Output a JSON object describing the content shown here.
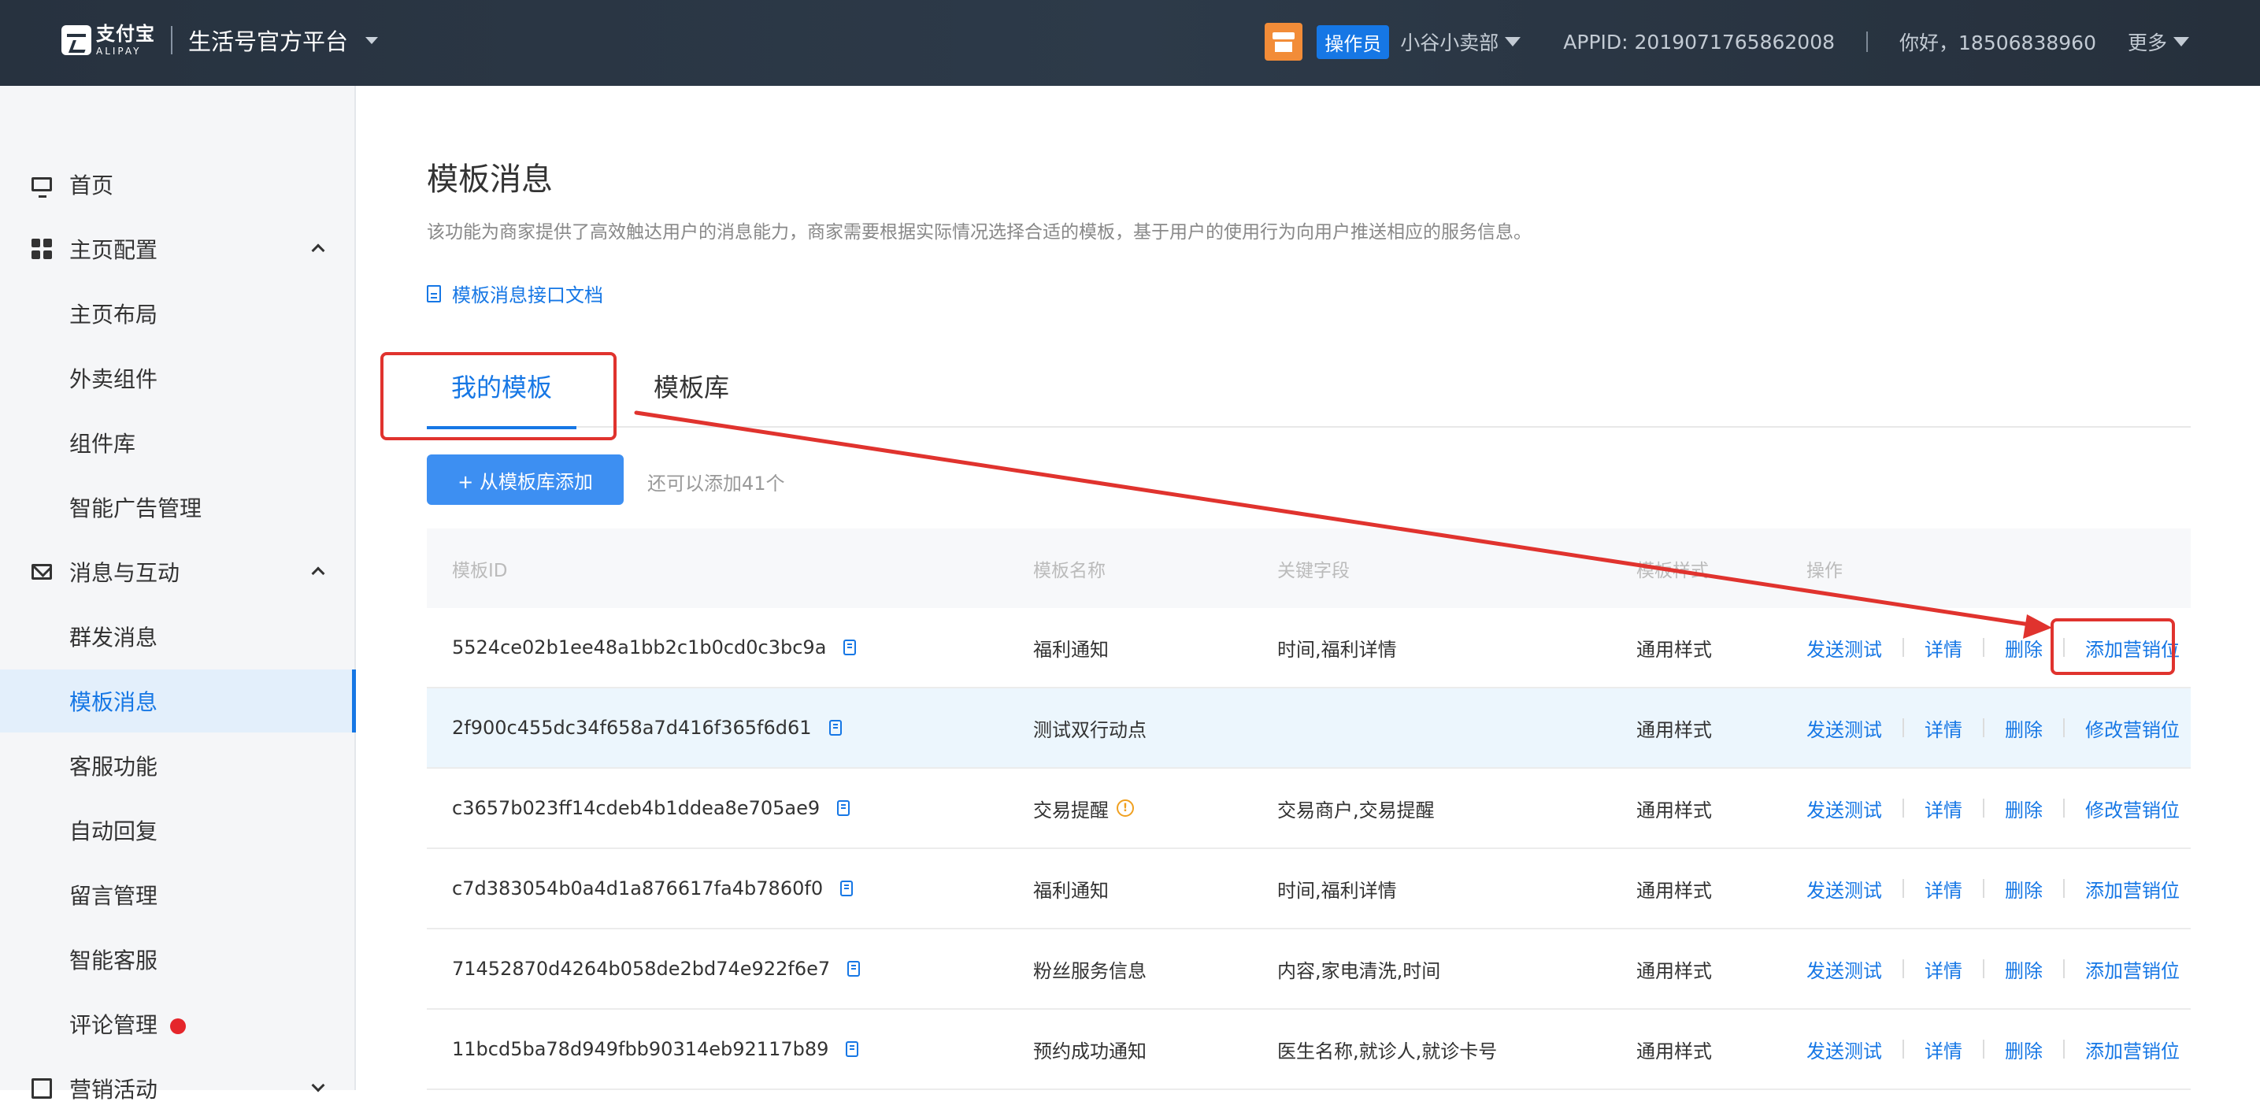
{
  "header": {
    "logo_cn": "支付宝",
    "logo_en": "ALIPAY",
    "platform": "生活号官方平台",
    "role_badge": "操作员",
    "merchant": "小谷小卖部",
    "appid": "APPID: 2019071765862008",
    "greeting": "你好，18506838960",
    "more": "更多"
  },
  "sidebar": {
    "items": [
      {
        "label": "首页",
        "icon": "monitor-icon"
      },
      {
        "label": "主页配置",
        "icon": "grid-icon"
      },
      {
        "label": "主页布局"
      },
      {
        "label": "外卖组件"
      },
      {
        "label": "组件库"
      },
      {
        "label": "智能广告管理"
      },
      {
        "label": "消息与互动",
        "icon": "mail-icon"
      },
      {
        "label": "群发消息"
      },
      {
        "label": "模板消息",
        "active": true
      },
      {
        "label": "客服功能"
      },
      {
        "label": "自动回复"
      },
      {
        "label": "留言管理"
      },
      {
        "label": "智能客服"
      },
      {
        "label": "评论管理"
      },
      {
        "label": "营销活动",
        "icon": "gift-icon"
      }
    ]
  },
  "main": {
    "title": "模板消息",
    "description": "该功能为商家提供了高效触达用户的消息能力，商家需要根据实际情况选择合适的模板，基于用户的使用行为向用户推送相应的服务信息。",
    "doc_link": "模板消息接口文档",
    "tabs": [
      {
        "label": "我的模板",
        "active": true
      },
      {
        "label": "模板库"
      }
    ],
    "add_button": "+ 从模板库添加",
    "remain_text": "还可以添加41个",
    "table": {
      "headers": [
        "模板ID",
        "模板名称",
        "关键字段",
        "模板样式",
        "操作"
      ],
      "rows": [
        {
          "id": "5524ce02b1ee48a1bb2c1b0cd0c3bc9a",
          "name": "福利通知",
          "keys": "时间,福利详情",
          "style": "通用样式",
          "ops": [
            "发送测试",
            "详情",
            "删除",
            "添加营销位"
          ]
        },
        {
          "id": "2f900c455dc34f658a7d416f365f6d61",
          "name": "测试双行动点",
          "keys": "",
          "style": "通用样式",
          "ops": [
            "发送测试",
            "详情",
            "删除",
            "修改营销位"
          ]
        },
        {
          "id": "c3657b023ff14cdeb4b1ddea8e705ae9",
          "name": "交易提醒",
          "keys": "交易商户,交易提醒",
          "style": "通用样式",
          "ops": [
            "发送测试",
            "详情",
            "删除",
            "修改营销位"
          ]
        },
        {
          "id": "c7d383054b0a4d1a876617fa4b7860f0",
          "name": "福利通知",
          "keys": "时间,福利详情",
          "style": "通用样式",
          "ops": [
            "发送测试",
            "详情",
            "删除",
            "添加营销位"
          ]
        },
        {
          "id": "71452870d4264b058de2bd74e922f6e7",
          "name": "粉丝服务信息",
          "keys": "内容,家电清洗,时间",
          "style": "通用样式",
          "ops": [
            "发送测试",
            "详情",
            "删除",
            "添加营销位"
          ]
        },
        {
          "id": "11bcd5ba78d949fbb90314eb92117b89",
          "name": "预约成功通知",
          "keys": "医生名称,就诊人,就诊卡号",
          "style": "通用样式",
          "ops": [
            "发送测试",
            "详情",
            "删除",
            "添加营销位"
          ]
        }
      ]
    }
  },
  "colors": {
    "accent": "#1677e5",
    "header_bg": "#27323f",
    "annotation": "#e0332e"
  }
}
